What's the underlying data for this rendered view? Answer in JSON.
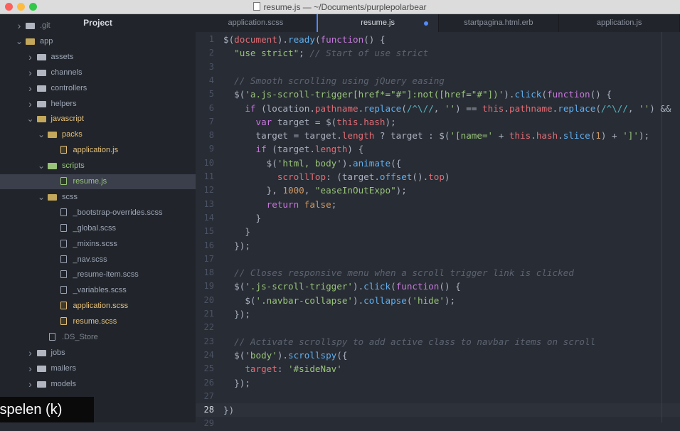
{
  "window": {
    "title": "resume.js — ~/Documents/purplepolarbear"
  },
  "sidebar": {
    "header": "Project",
    "rows": [
      {
        "label": ".git",
        "kind": "folder",
        "indent": 0,
        "expanded": false,
        "style": "dim"
      },
      {
        "label": "app",
        "kind": "folder",
        "indent": 0,
        "expanded": true,
        "style": "open"
      },
      {
        "label": "assets",
        "kind": "folder",
        "indent": 1,
        "expanded": false,
        "style": ""
      },
      {
        "label": "channels",
        "kind": "folder",
        "indent": 1,
        "expanded": false,
        "style": ""
      },
      {
        "label": "controllers",
        "kind": "folder",
        "indent": 1,
        "expanded": false,
        "style": ""
      },
      {
        "label": "helpers",
        "kind": "folder",
        "indent": 1,
        "expanded": false,
        "style": ""
      },
      {
        "label": "javascript",
        "kind": "folder",
        "indent": 1,
        "expanded": true,
        "style": "yellow"
      },
      {
        "label": "packs",
        "kind": "folder",
        "indent": 2,
        "expanded": true,
        "style": "yellow"
      },
      {
        "label": "application.js",
        "kind": "file",
        "indent": 3,
        "style": "yellow"
      },
      {
        "label": "scripts",
        "kind": "folder",
        "indent": 2,
        "expanded": true,
        "style": "green"
      },
      {
        "label": "resume.js",
        "kind": "file",
        "indent": 3,
        "style": "green",
        "selected": true
      },
      {
        "label": "scss",
        "kind": "folder",
        "indent": 2,
        "expanded": true,
        "style": "open"
      },
      {
        "label": "_bootstrap-overrides.scss",
        "kind": "file",
        "indent": 3,
        "style": ""
      },
      {
        "label": "_global.scss",
        "kind": "file",
        "indent": 3,
        "style": ""
      },
      {
        "label": "_mixins.scss",
        "kind": "file",
        "indent": 3,
        "style": ""
      },
      {
        "label": "_nav.scss",
        "kind": "file",
        "indent": 3,
        "style": ""
      },
      {
        "label": "_resume-item.scss",
        "kind": "file",
        "indent": 3,
        "style": ""
      },
      {
        "label": "_variables.scss",
        "kind": "file",
        "indent": 3,
        "style": ""
      },
      {
        "label": "application.scss",
        "kind": "file",
        "indent": 3,
        "style": "yellow"
      },
      {
        "label": "resume.scss",
        "kind": "file",
        "indent": 3,
        "style": "yellow"
      },
      {
        "label": ".DS_Store",
        "kind": "file",
        "indent": 2,
        "style": "dim"
      },
      {
        "label": "jobs",
        "kind": "folder",
        "indent": 1,
        "expanded": false,
        "style": ""
      },
      {
        "label": "mailers",
        "kind": "folder",
        "indent": 1,
        "expanded": false,
        "style": ""
      },
      {
        "label": "models",
        "kind": "folder",
        "indent": 1,
        "expanded": false,
        "style": ""
      }
    ]
  },
  "tabs": [
    {
      "label": "application.scss",
      "active": false,
      "modified": false
    },
    {
      "label": "resume.js",
      "active": true,
      "modified": true
    },
    {
      "label": "startpagina.html.erb",
      "active": false,
      "modified": false
    },
    {
      "label": "application.js",
      "active": false,
      "modified": false
    }
  ],
  "editor": {
    "current_line": 28,
    "lines": [
      [
        [
          "$(",
          "p"
        ],
        [
          "document",
          "v"
        ],
        [
          ").",
          "p"
        ],
        [
          "ready",
          "f"
        ],
        [
          "(",
          "p"
        ],
        [
          "function",
          "k"
        ],
        [
          "() {",
          "p"
        ]
      ],
      [
        [
          "  ",
          "p"
        ],
        [
          "\"use strict\"",
          "s"
        ],
        [
          "; ",
          "p"
        ],
        [
          "// Start of use strict",
          "c"
        ]
      ],
      [],
      [
        [
          "  ",
          "p"
        ],
        [
          "// Smooth scrolling using jQuery easing",
          "c"
        ]
      ],
      [
        [
          "  ",
          "p"
        ],
        [
          "$(",
          "p"
        ],
        [
          "'a.js-scroll-trigger[href*=\"#\"]:not([href=\"#\"])'",
          "s"
        ],
        [
          ").",
          "p"
        ],
        [
          "click",
          "f"
        ],
        [
          "(",
          "p"
        ],
        [
          "function",
          "k"
        ],
        [
          "() {",
          "p"
        ]
      ],
      [
        [
          "    ",
          "p"
        ],
        [
          "if",
          "k"
        ],
        [
          " (location.",
          "p"
        ],
        [
          "pathname",
          "v"
        ],
        [
          ".",
          "p"
        ],
        [
          "replace",
          "f"
        ],
        [
          "(",
          "p"
        ],
        [
          "/^\\//",
          "o"
        ],
        [
          ", ",
          "p"
        ],
        [
          "''",
          "s"
        ],
        [
          ") == ",
          "p"
        ],
        [
          "this",
          "v"
        ],
        [
          ".",
          "p"
        ],
        [
          "pathname",
          "v"
        ],
        [
          ".",
          "p"
        ],
        [
          "replace",
          "f"
        ],
        [
          "(",
          "p"
        ],
        [
          "/^\\//",
          "o"
        ],
        [
          ", ",
          "p"
        ],
        [
          "''",
          "s"
        ],
        [
          ") &&",
          "p"
        ]
      ],
      [
        [
          "      ",
          "p"
        ],
        [
          "var",
          "k"
        ],
        [
          " target = $(",
          "p"
        ],
        [
          "this",
          "v"
        ],
        [
          ".",
          "p"
        ],
        [
          "hash",
          "v"
        ],
        [
          ");",
          "p"
        ]
      ],
      [
        [
          "      target = target.",
          "p"
        ],
        [
          "length",
          "v"
        ],
        [
          " ? target : $(",
          "p"
        ],
        [
          "'[name='",
          "s"
        ],
        [
          " + ",
          "p"
        ],
        [
          "this",
          "v"
        ],
        [
          ".",
          "p"
        ],
        [
          "hash",
          "v"
        ],
        [
          ".",
          "p"
        ],
        [
          "slice",
          "f"
        ],
        [
          "(",
          "p"
        ],
        [
          "1",
          "n"
        ],
        [
          ") + ",
          "p"
        ],
        [
          "']'",
          "s"
        ],
        [
          ");",
          "p"
        ]
      ],
      [
        [
          "      ",
          "p"
        ],
        [
          "if",
          "k"
        ],
        [
          " (target.",
          "p"
        ],
        [
          "length",
          "v"
        ],
        [
          ") {",
          "p"
        ]
      ],
      [
        [
          "        $(",
          "p"
        ],
        [
          "'html, body'",
          "s"
        ],
        [
          ").",
          "p"
        ],
        [
          "animate",
          "f"
        ],
        [
          "({",
          "p"
        ]
      ],
      [
        [
          "          ",
          "p"
        ],
        [
          "scrollTop",
          "v"
        ],
        [
          ": (target.",
          "p"
        ],
        [
          "offset",
          "f"
        ],
        [
          "().",
          "p"
        ],
        [
          "top",
          "v"
        ],
        [
          ")",
          "p"
        ]
      ],
      [
        [
          "        }, ",
          "p"
        ],
        [
          "1000",
          "n"
        ],
        [
          ", ",
          "p"
        ],
        [
          "\"easeInOutExpo\"",
          "s"
        ],
        [
          ");",
          "p"
        ]
      ],
      [
        [
          "        ",
          "p"
        ],
        [
          "return",
          "k"
        ],
        [
          " ",
          "p"
        ],
        [
          "false",
          "n"
        ],
        [
          ";",
          "p"
        ]
      ],
      [
        [
          "      }",
          "p"
        ]
      ],
      [
        [
          "    }",
          "p"
        ]
      ],
      [
        [
          "  });",
          "p"
        ]
      ],
      [],
      [
        [
          "  ",
          "p"
        ],
        [
          "// Closes responsive menu when a scroll trigger link is clicked",
          "c"
        ]
      ],
      [
        [
          "  $(",
          "p"
        ],
        [
          "'.js-scroll-trigger'",
          "s"
        ],
        [
          ").",
          "p"
        ],
        [
          "click",
          "f"
        ],
        [
          "(",
          "p"
        ],
        [
          "function",
          "k"
        ],
        [
          "() {",
          "p"
        ]
      ],
      [
        [
          "    $(",
          "p"
        ],
        [
          "'.navbar-collapse'",
          "s"
        ],
        [
          ").",
          "p"
        ],
        [
          "collapse",
          "f"
        ],
        [
          "(",
          "p"
        ],
        [
          "'hide'",
          "s"
        ],
        [
          ");",
          "p"
        ]
      ],
      [
        [
          "  });",
          "p"
        ]
      ],
      [],
      [
        [
          "  ",
          "p"
        ],
        [
          "// Activate scrollspy to add active class to navbar items on scroll",
          "c"
        ]
      ],
      [
        [
          "  $(",
          "p"
        ],
        [
          "'body'",
          "s"
        ],
        [
          ").",
          "p"
        ],
        [
          "scrollspy",
          "f"
        ],
        [
          "({",
          "p"
        ]
      ],
      [
        [
          "    ",
          "p"
        ],
        [
          "target",
          "v"
        ],
        [
          ": ",
          "p"
        ],
        [
          "'#sideNav'",
          "s"
        ]
      ],
      [
        [
          "  });",
          "p"
        ]
      ],
      [],
      [
        [
          "})",
          "p"
        ]
      ],
      []
    ]
  },
  "overlay": {
    "text": "fspelen (k)"
  },
  "colors": {
    "accent": "#528bff",
    "background": "#282c34",
    "sidebar": "#21252b"
  }
}
